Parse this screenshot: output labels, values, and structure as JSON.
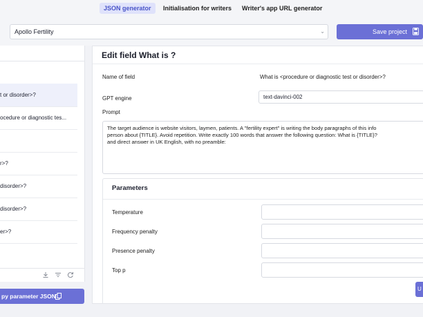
{
  "tabs": [
    {
      "label": "JSON generator",
      "active": true
    },
    {
      "label": "Initialisation for writers",
      "active": false
    },
    {
      "label": "Writer's app URL generator",
      "active": false
    }
  ],
  "project": {
    "selected": "Apollo Fertility",
    "save_label": "Save project"
  },
  "sidebar": {
    "items": [
      {
        "label": "t or disorder>?",
        "selected": true
      },
      {
        "label": "ocedure or diagnostic tes...",
        "selected": false
      },
      {
        "label": "",
        "selected": false
      },
      {
        "label": "r>?",
        "selected": false
      },
      {
        "label": "disorder>?",
        "selected": false
      },
      {
        "label": "disorder>?",
        "selected": false
      },
      {
        "label": "er>?",
        "selected": false
      }
    ],
    "copy_label": "py parameter JSON"
  },
  "editor": {
    "title": "Edit field What is ?",
    "name_label": "Name of field",
    "name_value": "What is <procedure or diagnostic test or disorder>?",
    "engine_label": "GPT engine",
    "engine_value": "text-davinci-002",
    "prompt_label": "Prompt",
    "prompt_lines": [
      "The target audience is website visitors, laymen, patients. A \"fertility expert\" is writing the body paragraphs of this info",
      "person about {TITLE}. Avoid repetition. Write exactly 100 words that answer the following question: What is {TITLE}?",
      "and direct answer in UK English, with no preamble:"
    ],
    "params_title": "Parameters",
    "params": [
      {
        "label": "Temperature",
        "value": ""
      },
      {
        "label": "Frequency penalty",
        "value": ""
      },
      {
        "label": "Presence penalty",
        "value": ""
      },
      {
        "label": "Top p",
        "value": ""
      }
    ],
    "update_label": "U"
  }
}
